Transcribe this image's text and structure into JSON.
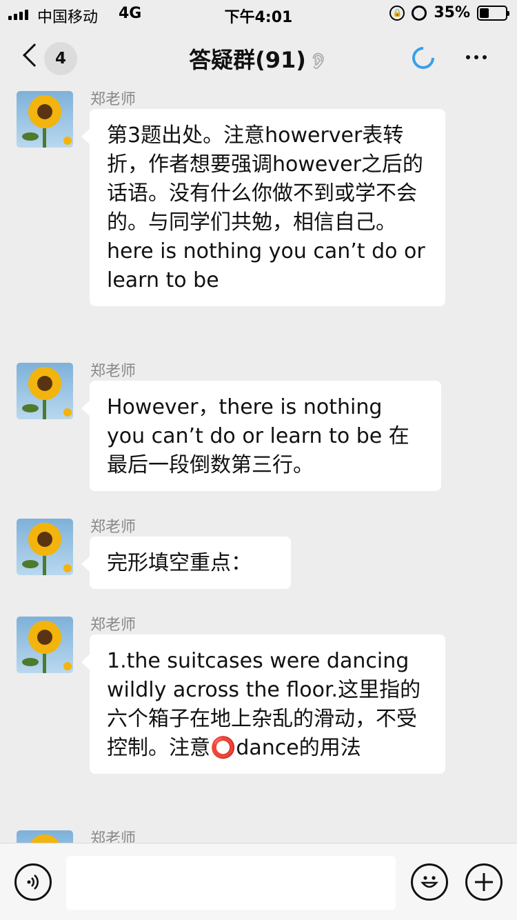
{
  "status_bar": {
    "carrier": "中国移动",
    "network": "4G",
    "time": "下午4:01",
    "battery_percent": "35%",
    "battery_level": 0.35
  },
  "nav": {
    "back_count": "4",
    "title": "答疑群(91)",
    "icons": [
      "back-arrow-icon",
      "mute-icon",
      "loading-icon",
      "more-icon"
    ]
  },
  "messages": [
    {
      "sender": "郑老师",
      "text": "第3题出处。注意howerver表转折，作者想要强调however之后的话语。没有什么你做不到或学不会的。与同学们共勉，相信自己。here is nothing you can’t do or learn to be"
    },
    {
      "sender": "郑老师",
      "text": "However，there is nothing you can’t do or learn to be 在最后一段倒数第三行。"
    },
    {
      "sender": "郑老师",
      "text": "完形填空重点："
    },
    {
      "sender": "郑老师",
      "text": "1.the suitcases were dancing wildly across the floor.这里指的六个箱子在地上杂乱的滑动，不受控制。注意⭕dance的用法"
    },
    {
      "sender": "郑老师",
      "text": ""
    }
  ],
  "input_bar": {
    "placeholder": "",
    "icons": [
      "voice-icon",
      "emoji-icon",
      "plus-icon"
    ]
  },
  "colors": {
    "background": "#ededed",
    "bubble": "#ffffff",
    "accent_loading": "#3aa0e8",
    "sender_text": "#888888"
  }
}
